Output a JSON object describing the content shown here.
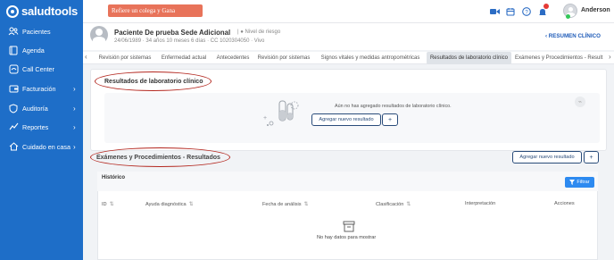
{
  "app": {
    "logo_text": "saludtools"
  },
  "sidebar": {
    "items": [
      {
        "label": "Pacientes",
        "icon": "users-icon",
        "has_chevron": false
      },
      {
        "label": "Agenda",
        "icon": "book-icon",
        "has_chevron": false
      },
      {
        "label": "Call Center",
        "icon": "headset-icon",
        "has_chevron": false
      },
      {
        "label": "Facturación",
        "icon": "wallet-icon",
        "has_chevron": true
      },
      {
        "label": "Auditoría",
        "icon": "shield-icon",
        "has_chevron": true
      },
      {
        "label": "Reportes",
        "icon": "chart-icon",
        "has_chevron": true
      },
      {
        "label": "Cuidado en casa",
        "icon": "home-icon",
        "has_chevron": true
      }
    ]
  },
  "topbar": {
    "refer_label": "Refiere un colega y Gana",
    "user_name": "Anderson",
    "notification_count": "1"
  },
  "patient": {
    "name": "Paciente De prueba Sede Adicional",
    "risk_label": "Nivel de riesgo",
    "meta": "24/06/1989 · 34 años 10 meses 6 días · CC 1020304050 · Vivo",
    "summary_label": "RESUMEN CLÍNICO"
  },
  "tabs": [
    {
      "label": "Revisión por sistemas",
      "active": false
    },
    {
      "label": "Enfermedad actual",
      "active": false
    },
    {
      "label": "Antecedentes",
      "active": false
    },
    {
      "label": "Revisión por sistemas",
      "active": false
    },
    {
      "label": "Signos vitales y medidas antropométricas",
      "active": false
    },
    {
      "label": "Resultados de laboratorio clínico",
      "active": true
    },
    {
      "label": "Exámenes y Procedimientos - Result",
      "active": false
    }
  ],
  "lab": {
    "title": "Resultados de laboratorio clínico",
    "empty_text": "Aún no has agregado resultados de laboratorio clínico.",
    "add_label": "Agregar nuevo resultado",
    "add_plus": "+"
  },
  "exams": {
    "title": "Exámenes y Procedimientos - Resultados",
    "add_label": "Agregar nuevo resultado",
    "add_plus": "+",
    "history_title": "Histórico",
    "filter_label": "Filtrar",
    "columns": [
      "ID",
      "Ayuda diagnóstica",
      "Fecha de análisis",
      "Clasificación",
      "Interpretación",
      "Acciones"
    ],
    "no_data": "No hay datos para mostrar"
  },
  "colors": {
    "sidebar": "#1e6ec8",
    "refer": "#e8735a",
    "accent": "#2d8af0",
    "annotation": "#b3261e"
  }
}
